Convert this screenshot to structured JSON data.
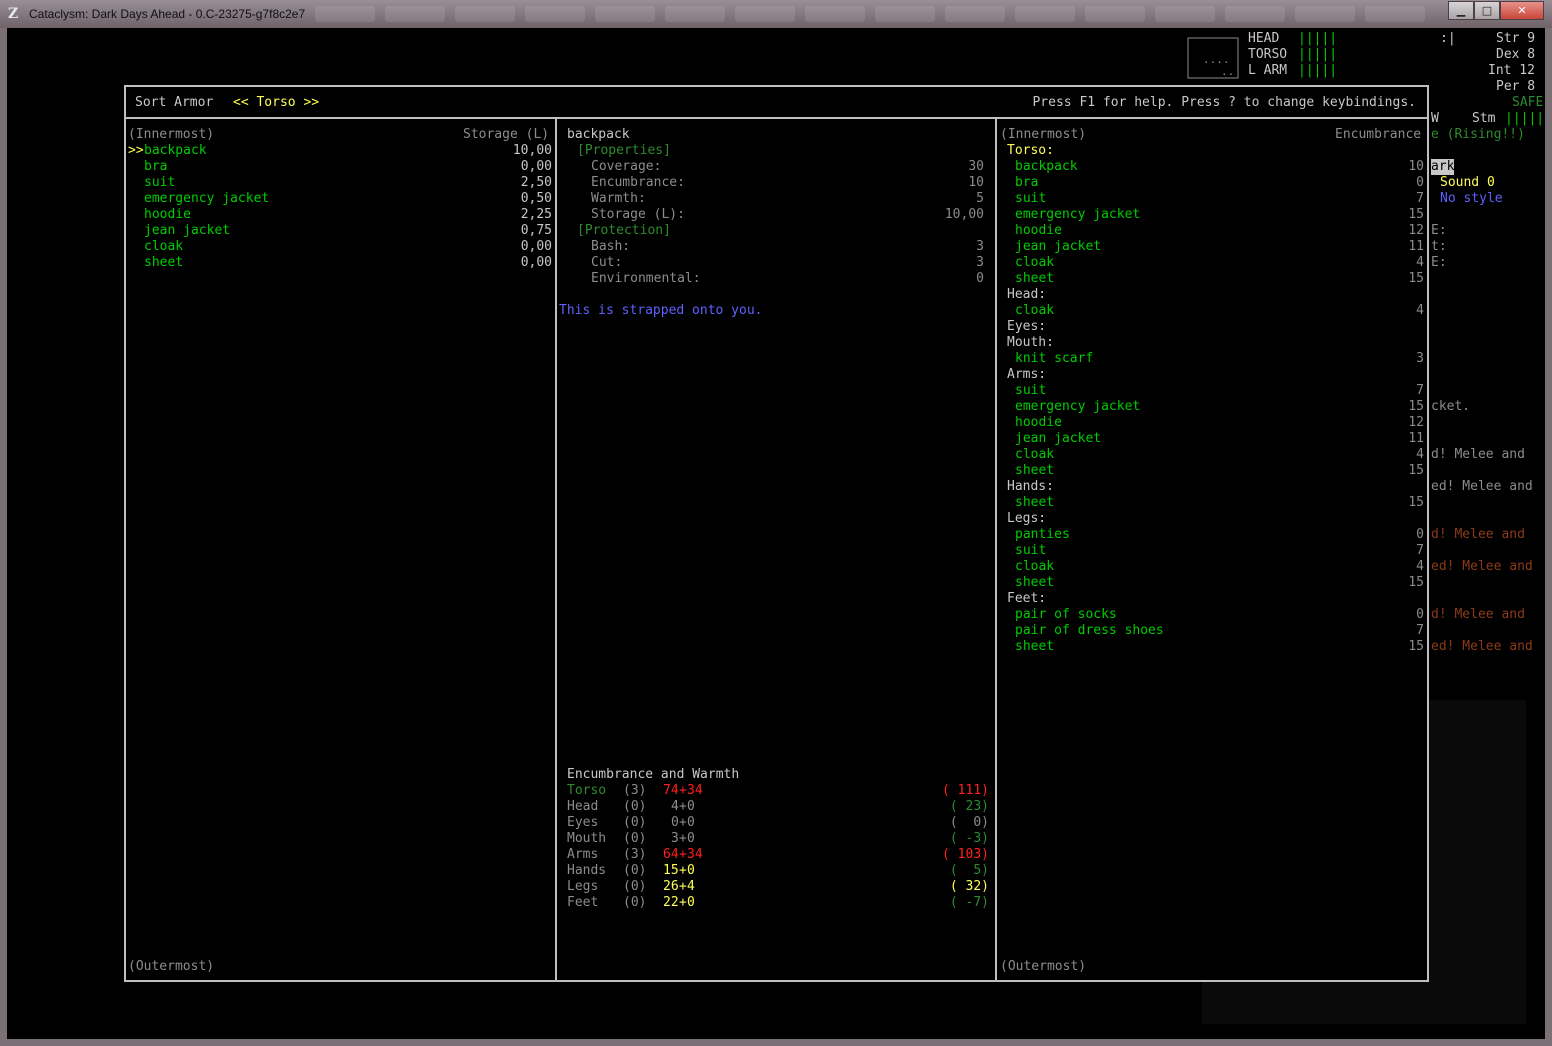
{
  "window": {
    "title": "Cataclysm: Dark Days Ahead - 0.C-23275-g7f8c2e7",
    "minimize": "▁",
    "maximize": "□",
    "close": "✕"
  },
  "hud": {
    "body_parts": [
      {
        "label": "HEAD",
        "bar": "|||||"
      },
      {
        "label": "TORSO",
        "bar": "|||||"
      },
      {
        "label": "L ARM",
        "bar": "|||||"
      }
    ],
    "face": ":|",
    "stats": [
      "Str 9",
      "Dex 8",
      "Int 12",
      "Per 8"
    ],
    "safe": "SAFE",
    "w_label": "W",
    "stm_label": "Stm",
    "stm_bar": "|||||",
    "rising": "e (Rising!!)",
    "dark": "ark",
    "sound": "Sound 0",
    "style": "No style",
    "sidebar_letters": [
      "E:",
      "t:",
      "E:"
    ],
    "log": [
      {
        "text": "cket.",
        "color": "#8c8c8c"
      },
      {
        "text": "d! Melee and",
        "color": "#8c8c8c"
      },
      {
        "text": "ed! Melee and",
        "color": "#8c8c8c"
      },
      {
        "text": "d! Melee and",
        "color": "#8b3a1a"
      },
      {
        "text": "ed! Melee and",
        "color": "#8b3a1a"
      },
      {
        "text": "d! Melee and",
        "color": "#8b3a1a"
      },
      {
        "text": "ed! Melee and",
        "color": "#8b3a1a"
      }
    ]
  },
  "dialog": {
    "sort_label": "Sort Armor",
    "category": "<< Torso >>",
    "help": "Press F1 for help. Press ? to change keybindings.",
    "left": {
      "innermost": "(Innermost)",
      "storage_header": "Storage (L)",
      "cursor": ">>",
      "items": [
        {
          "name": "backpack",
          "storage": "10,00"
        },
        {
          "name": "bra",
          "storage": "0,00"
        },
        {
          "name": "suit",
          "storage": "2,50"
        },
        {
          "name": "emergency jacket",
          "storage": "0,50"
        },
        {
          "name": "hoodie",
          "storage": "2,25"
        },
        {
          "name": "jean jacket",
          "storage": "0,75"
        },
        {
          "name": "cloak",
          "storage": "0,00"
        },
        {
          "name": "sheet",
          "storage": "0,00"
        }
      ],
      "outermost": "(Outermost)"
    },
    "middle": {
      "item_name": "backpack",
      "properties_header": "[Properties]",
      "properties": [
        {
          "label": "Coverage:",
          "value": "30"
        },
        {
          "label": "Encumbrance:",
          "value": "10"
        },
        {
          "label": "Warmth:",
          "value": "5"
        },
        {
          "label": "Storage (L):",
          "value": "10,00"
        }
      ],
      "protection_header": "[Protection]",
      "protection": [
        {
          "label": "Bash:",
          "value": "3"
        },
        {
          "label": "Cut:",
          "value": "3"
        },
        {
          "label": "Environmental:",
          "value": "0"
        }
      ],
      "description": "This is strapped onto you.",
      "enc_header": "Encumbrance and Warmth",
      "enc_rows": [
        {
          "part": "Torso",
          "layers": "(3)",
          "enc_a": "74",
          "plus": "+",
          "enc_b": "34",
          "warmth": "( 111)",
          "part_color": "#2e8b2e",
          "a_color": "#ff2020",
          "b_color": "#ff2020",
          "w_color": "#ff2020"
        },
        {
          "part": "Head",
          "layers": "(0)",
          "enc_a": "4",
          "plus": "+",
          "enc_b": "0",
          "warmth": "( 23)",
          "part_color": "#8c8c8c",
          "a_color": "#8c8c8c",
          "b_color": "#8c8c8c",
          "w_color": "#2e8b2e"
        },
        {
          "part": "Eyes",
          "layers": "(0)",
          "enc_a": "0",
          "plus": "+",
          "enc_b": "0",
          "warmth": "(  0)",
          "part_color": "#8c8c8c",
          "a_color": "#8c8c8c",
          "b_color": "#8c8c8c",
          "w_color": "#8c8c8c"
        },
        {
          "part": "Mouth",
          "layers": "(0)",
          "enc_a": "3",
          "plus": "+",
          "enc_b": "0",
          "warmth": "( -3)",
          "part_color": "#8c8c8c",
          "a_color": "#8c8c8c",
          "b_color": "#8c8c8c",
          "w_color": "#2e8b2e"
        },
        {
          "part": "Arms",
          "layers": "(3)",
          "enc_a": "64",
          "plus": "+",
          "enc_b": "34",
          "warmth": "( 103)",
          "part_color": "#8c8c8c",
          "a_color": "#ff2020",
          "b_color": "#ff2020",
          "w_color": "#ff2020"
        },
        {
          "part": "Hands",
          "layers": "(0)",
          "enc_a": "15",
          "plus": "+",
          "enc_b": "0",
          "warmth": "(  5)",
          "part_color": "#8c8c8c",
          "a_color": "#ffff55",
          "b_color": "#ffff55",
          "w_color": "#2e8b2e"
        },
        {
          "part": "Legs",
          "layers": "(0)",
          "enc_a": "26",
          "plus": "+",
          "enc_b": "4",
          "warmth": "( 32)",
          "part_color": "#8c8c8c",
          "a_color": "#ffff55",
          "b_color": "#ffff55",
          "w_color": "#ffff55"
        },
        {
          "part": "Feet",
          "layers": "(0)",
          "enc_a": "22",
          "plus": "+",
          "enc_b": "0",
          "warmth": "( -7)",
          "part_color": "#8c8c8c",
          "a_color": "#ffff55",
          "b_color": "#ffff55",
          "w_color": "#2e8b2e"
        }
      ]
    },
    "right": {
      "innermost": "(Innermost)",
      "enc_header": "Encumbrance",
      "groups": [
        {
          "part": "Torso:",
          "items": [
            {
              "name": "backpack",
              "enc": "10"
            },
            {
              "name": "bra",
              "enc": "0"
            },
            {
              "name": "suit",
              "enc": "7"
            },
            {
              "name": "emergency jacket",
              "enc": "15"
            },
            {
              "name": "hoodie",
              "enc": "12"
            },
            {
              "name": "jean jacket",
              "enc": "11"
            },
            {
              "name": "cloak",
              "enc": "4"
            },
            {
              "name": "sheet",
              "enc": "15"
            }
          ]
        },
        {
          "part": "Head:",
          "items": [
            {
              "name": "cloak",
              "enc": "4"
            }
          ]
        },
        {
          "part": "Eyes:",
          "items": []
        },
        {
          "part": "Mouth:",
          "items": [
            {
              "name": "knit scarf",
              "enc": "3"
            }
          ]
        },
        {
          "part": "Arms:",
          "items": [
            {
              "name": "suit",
              "enc": "7"
            },
            {
              "name": "emergency jacket",
              "enc": "15"
            },
            {
              "name": "hoodie",
              "enc": "12"
            },
            {
              "name": "jean jacket",
              "enc": "11"
            },
            {
              "name": "cloak",
              "enc": "4"
            },
            {
              "name": "sheet",
              "enc": "15"
            }
          ]
        },
        {
          "part": "Hands:",
          "items": [
            {
              "name": "sheet",
              "enc": "15"
            }
          ]
        },
        {
          "part": "Legs:",
          "items": [
            {
              "name": "panties",
              "enc": "0"
            },
            {
              "name": "suit",
              "enc": "7"
            },
            {
              "name": "cloak",
              "enc": "4"
            },
            {
              "name": "sheet",
              "enc": "15"
            }
          ]
        },
        {
          "part": "Feet:",
          "items": [
            {
              "name": "pair of socks",
              "enc": "0"
            },
            {
              "name": "pair of dress shoes",
              "enc": "7"
            },
            {
              "name": "sheet",
              "enc": "15"
            }
          ]
        }
      ],
      "outermost": "(Outermost)"
    }
  }
}
